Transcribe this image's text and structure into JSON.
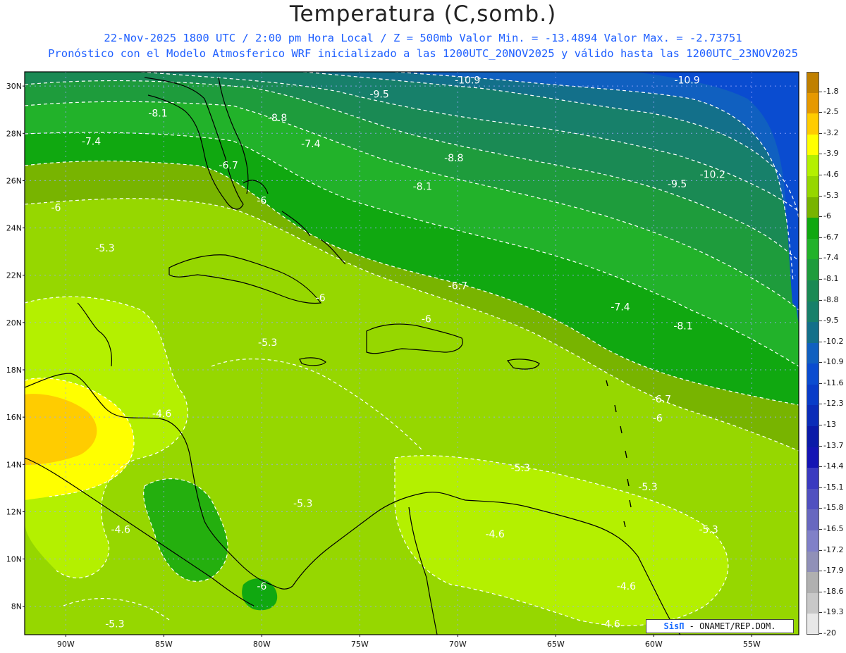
{
  "header": {
    "title": "Temperatura (C,somb.)",
    "line1": "22-Nov-2025  1800 UTC / 2:00 pm Hora Local / Z = 500mb  Valor Min. = -13.4894  Valor Max. = -2.73751",
    "line2": "Pronóstico con el Modelo Atmosferico WRF inicializado a las 1200UTC_20NOV2025 y válido hasta las  1200UTC_23NOV2025"
  },
  "map": {
    "lat_labels": [
      "30N",
      "28N",
      "26N",
      "24N",
      "22N",
      "20N",
      "18N",
      "16N",
      "14N",
      "12N",
      "10N",
      "8N"
    ],
    "lon_labels": [
      "90W",
      "85W",
      "80W",
      "75W",
      "70W",
      "65W",
      "60W",
      "55W"
    ],
    "contour_labels": [
      {
        "text": "-10.9",
        "lon": -69.5,
        "lat": 30.2
      },
      {
        "text": "-10.9",
        "lon": -58.3,
        "lat": 30.2
      },
      {
        "text": "-9.5",
        "lon": -74.0,
        "lat": 29.6
      },
      {
        "text": "-8.1",
        "lon": -85.3,
        "lat": 28.8
      },
      {
        "text": "-8.8",
        "lon": -79.2,
        "lat": 28.6
      },
      {
        "text": "-7.4",
        "lon": -88.7,
        "lat": 27.6
      },
      {
        "text": "-7.4",
        "lon": -77.5,
        "lat": 27.5
      },
      {
        "text": "-8.8",
        "lon": -70.2,
        "lat": 26.9
      },
      {
        "text": "-6.7",
        "lon": -81.7,
        "lat": 26.6
      },
      {
        "text": "-10.2",
        "lon": -57.0,
        "lat": 26.2
      },
      {
        "text": "-9.5",
        "lon": -58.8,
        "lat": 25.8
      },
      {
        "text": "-8.1",
        "lon": -71.8,
        "lat": 25.7
      },
      {
        "text": "-6",
        "lon": -80.0,
        "lat": 25.1
      },
      {
        "text": "-6",
        "lon": -90.5,
        "lat": 24.8
      },
      {
        "text": "-5.3",
        "lon": -88.0,
        "lat": 23.1
      },
      {
        "text": "-6.7",
        "lon": -70.0,
        "lat": 21.5
      },
      {
        "text": "-6",
        "lon": -77.0,
        "lat": 21.0
      },
      {
        "text": "-7.4",
        "lon": -61.7,
        "lat": 20.6
      },
      {
        "text": "-6",
        "lon": -71.6,
        "lat": 20.1
      },
      {
        "text": "-8.1",
        "lon": -58.5,
        "lat": 19.8
      },
      {
        "text": "-5.3",
        "lon": -79.7,
        "lat": 19.1
      },
      {
        "text": "-6.7",
        "lon": -59.6,
        "lat": 16.7
      },
      {
        "text": "-6",
        "lon": -59.8,
        "lat": 15.9
      },
      {
        "text": "-4.6",
        "lon": -85.1,
        "lat": 16.1
      },
      {
        "text": "-5.3",
        "lon": -66.8,
        "lat": 13.8
      },
      {
        "text": "-5.3",
        "lon": -60.3,
        "lat": 13.0
      },
      {
        "text": "-5.3",
        "lon": -77.9,
        "lat": 12.3
      },
      {
        "text": "-5.3",
        "lon": -57.2,
        "lat": 11.2
      },
      {
        "text": "-4.6",
        "lon": -87.2,
        "lat": 11.2
      },
      {
        "text": "-4.6",
        "lon": -68.1,
        "lat": 11.0
      },
      {
        "text": "-6",
        "lon": -80.0,
        "lat": 8.8
      },
      {
        "text": "-4.6",
        "lon": -61.4,
        "lat": 8.8
      },
      {
        "text": "-5.3",
        "lon": -87.5,
        "lat": 7.2
      },
      {
        "text": "-4.6",
        "lon": -62.2,
        "lat": 7.2
      }
    ],
    "credit_logo": "SisΠ",
    "credit_text": "- ONAMET/REP.DOM."
  },
  "colorbar": {
    "labels": [
      "-1.8",
      "-2.5",
      "-3.2",
      "-3.9",
      "-4.6",
      "-5.3",
      "-6",
      "-6.7",
      "-7.4",
      "-8.1",
      "-8.8",
      "-9.5",
      "-10.2",
      "-10.9",
      "-11.6",
      "-12.3",
      "-13",
      "-13.7",
      "-14.4",
      "-15.1",
      "-15.8",
      "-16.5",
      "-17.2",
      "-17.9",
      "-18.6",
      "-19.3",
      "-20"
    ],
    "colors": [
      "#c08000",
      "#e69900",
      "#ffcc00",
      "#ffff00",
      "#b4f000",
      "#96d700",
      "#78b400",
      "#10a810",
      "#22b22a",
      "#1e9c3c",
      "#1a8a54",
      "#17806a",
      "#13708a",
      "#1060c0",
      "#0a4cd0",
      "#083cc8",
      "#0a2cb8",
      "#0a1aa8",
      "#1414b4",
      "#3a3ac0",
      "#5050c0",
      "#6868c0",
      "#8080c8",
      "#9090b8",
      "#b0b0b0",
      "#c8c8c8",
      "#e8e8e8"
    ]
  }
}
